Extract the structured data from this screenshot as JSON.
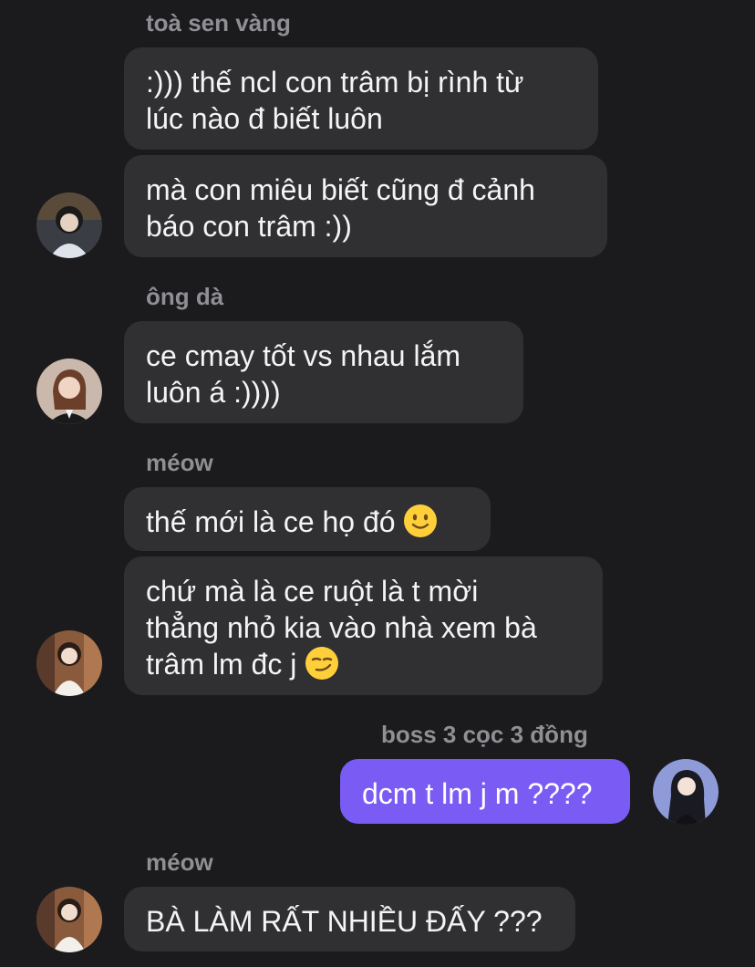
{
  "messages": [
    {
      "sender": "toà sen vàng",
      "lines": [
        ":))) thế ncl con trâm bị rình từ",
        "lúc nào đ biết luôn"
      ]
    },
    {
      "lines": [
        "mà con miêu biết cũng đ cảnh",
        "báo con trâm :))"
      ]
    },
    {
      "sender": "ông dà",
      "lines": [
        "ce cmay tốt vs nhau lắm",
        "luôn á :))))"
      ]
    },
    {
      "sender": "méow",
      "text": "thế mới là ce họ đó",
      "emoji": "slightly-smiling-face-icon"
    },
    {
      "lines": [
        "chứ mà là ce ruột là t mời",
        "thẳng nhỏ kia vào nhà xem bà"
      ],
      "last_line": "trâm lm đc j",
      "emoji": "smirking-face-icon"
    },
    {
      "sender": "boss 3 cọc 3 đồng",
      "text": "dcm t lm j m ????",
      "outgoing": true
    },
    {
      "sender": "méow",
      "text": "BÀ LÀM RẤT NHIỀU ĐẤY ???"
    }
  ],
  "colors": {
    "background": "#1b1b1d",
    "incoming_bubble": "#303033",
    "outgoing_bubble": "#7a5cf5",
    "sender_name": "#8f8f94"
  }
}
